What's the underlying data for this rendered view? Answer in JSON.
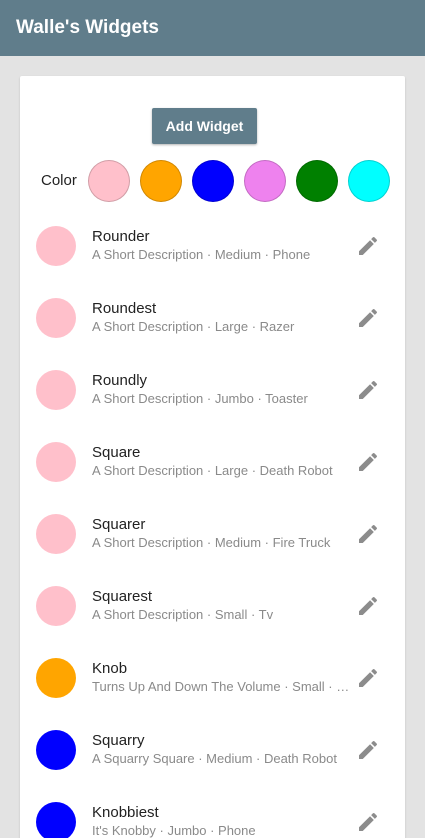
{
  "appbar": {
    "title": "Walle's Widgets"
  },
  "actions": {
    "add_label": "Add Widget"
  },
  "color_filter": {
    "label": "Color",
    "swatches": [
      {
        "name": "pink",
        "color": "#ffc0cb"
      },
      {
        "name": "orange",
        "color": "#ffa500"
      },
      {
        "name": "blue",
        "color": "#0000ff"
      },
      {
        "name": "violet",
        "color": "#ee82ee"
      },
      {
        "name": "green",
        "color": "#008000"
      },
      {
        "name": "cyan",
        "color": "#00ffff"
      }
    ]
  },
  "widgets": [
    {
      "name": "Rounder",
      "description": "A Short Description · Medium · Phone",
      "color": "#ffc0cb",
      "icon": "pencil-icon"
    },
    {
      "name": "Roundest",
      "description": "A Short Description · Large · Razer",
      "color": "#ffc0cb",
      "icon": "pencil-icon"
    },
    {
      "name": "Roundly",
      "description": "A Short Description · Jumbo · Toaster",
      "color": "#ffc0cb",
      "icon": "pencil-icon"
    },
    {
      "name": "Square",
      "description": "A Short Description · Large · Death Robot",
      "color": "#ffc0cb",
      "icon": "pencil-icon"
    },
    {
      "name": "Squarer",
      "description": "A Short Description · Medium · Fire Truck",
      "color": "#ffc0cb",
      "icon": "pencil-icon"
    },
    {
      "name": "Squarest",
      "description": "A Short Description · Small · Tv",
      "color": "#ffc0cb",
      "icon": "pencil-icon"
    },
    {
      "name": "Knob",
      "description": "Turns Up And Down The Volume · Small · Radio",
      "color": "#ffa500",
      "icon": "pencil-icon"
    },
    {
      "name": "Squarry",
      "description": "A Squarry Square · Medium · Death Robot",
      "color": "#0000ff",
      "icon": "pencil-icon"
    },
    {
      "name": "Knobbiest",
      "description": "It's Knobby · Jumbo · Phone",
      "color": "#0000ff",
      "icon": "pencil-icon"
    }
  ]
}
